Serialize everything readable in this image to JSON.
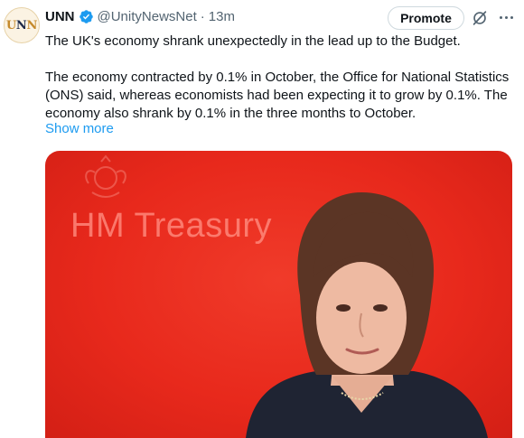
{
  "account": {
    "avatar_text": "UNN",
    "display_name": "UNN",
    "handle": "@UnityNewsNet",
    "separator": "·",
    "timestamp": "13m",
    "verified": true
  },
  "actions": {
    "promote_label": "Promote",
    "grok_icon": "grok-icon",
    "more_icon": "more-icon"
  },
  "tweet": {
    "headline": "The UK's economy shrank unexpectedly in the lead up to the Budget.",
    "body": "The economy contracted by 0.1% in October, the Office for National Statistics (ONS) said, whereas economists had been expecting it to grow by 0.1%. The economy also shrank by 0.1% in the three months to October.",
    "show_more": "Show more"
  },
  "media": {
    "background_text": "HM Treasury"
  },
  "colors": {
    "link": "#1d9bf0",
    "secondary_text": "#536471",
    "verified_badge": "#1d9bf0",
    "media_background": "#e8291c"
  }
}
